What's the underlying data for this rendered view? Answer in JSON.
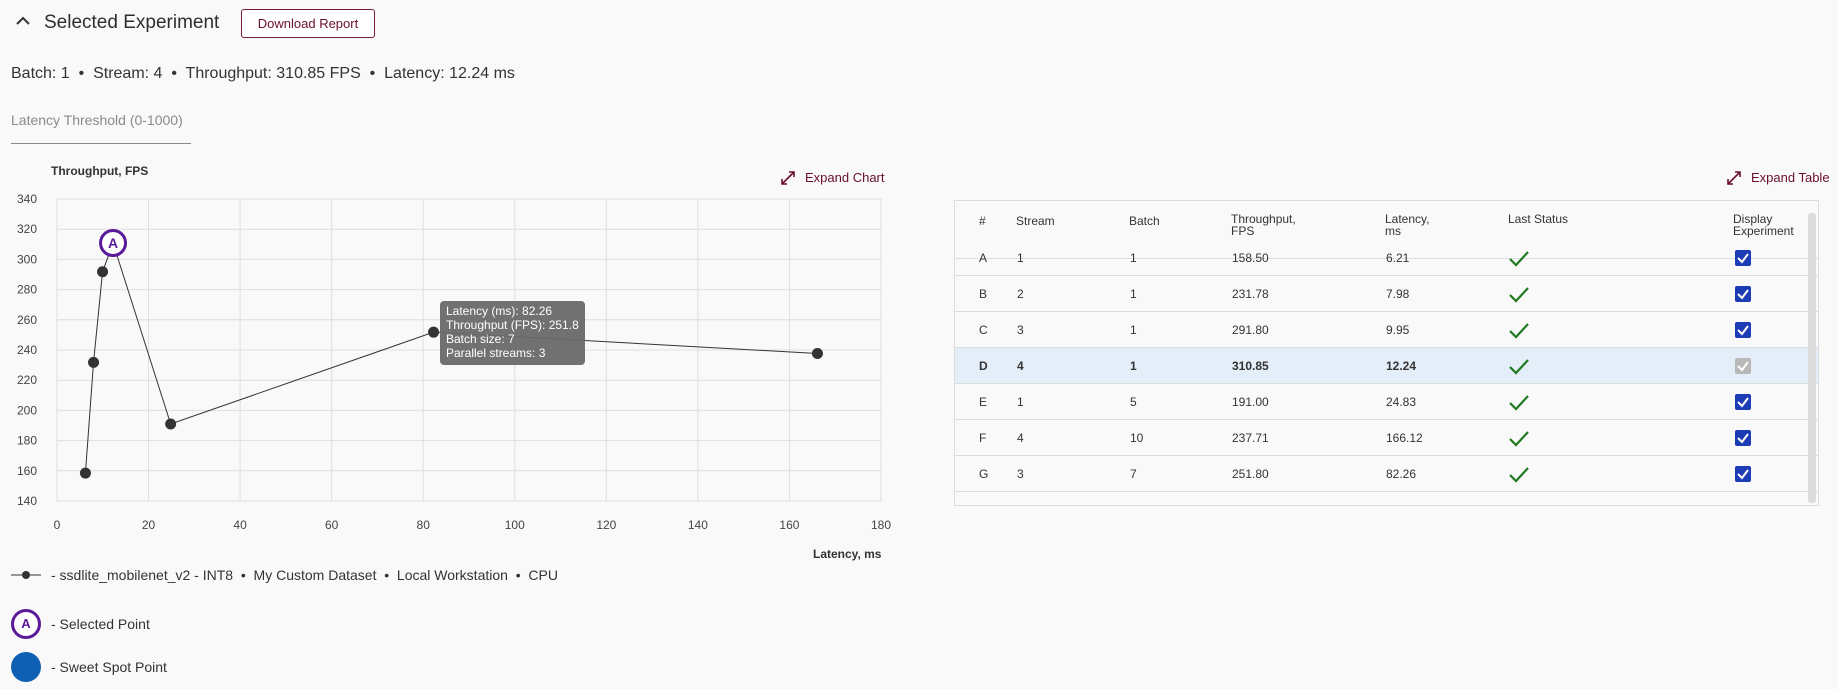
{
  "header": {
    "title": "Selected Experiment",
    "download_label": "Download Report"
  },
  "summary": "Batch: 1  •  Stream: 4  •  Throughput: 310.85 FPS  •  Latency: 12.24 ms",
  "threshold": {
    "placeholder": "Latency Threshold (0-1000)",
    "value": ""
  },
  "chart_controls": {
    "expand_label": "Expand Chart"
  },
  "table_controls": {
    "expand_label": "Expand Table"
  },
  "chart_data": {
    "type": "line",
    "ylabel": "Throughput, FPS",
    "xlabel": "Latency, ms",
    "xlim": [
      0,
      180
    ],
    "ylim": [
      140,
      340
    ],
    "x_ticks": [
      0,
      20,
      40,
      60,
      80,
      100,
      120,
      140,
      160,
      180
    ],
    "y_ticks": [
      140,
      160,
      180,
      200,
      220,
      240,
      260,
      280,
      300,
      320,
      340
    ],
    "grid": true,
    "series": [
      {
        "name": "ssdlite_mobilenet_v2 - INT8",
        "points": [
          {
            "x": 6.21,
            "y": 158.5
          },
          {
            "x": 7.98,
            "y": 231.78
          },
          {
            "x": 9.95,
            "y": 291.8
          },
          {
            "x": 12.24,
            "y": 310.85
          },
          {
            "x": 24.83,
            "y": 191.0
          },
          {
            "x": 82.26,
            "y": 251.8
          },
          {
            "x": 166.12,
            "y": 237.71
          }
        ]
      }
    ],
    "selected_point": {
      "label": "A",
      "x": 12.24,
      "y": 310.85
    },
    "tooltip": {
      "latency": "Latency (ms): 82.26",
      "throughput": "Throughput (FPS): 251.8",
      "batch": "Batch size: 7",
      "streams": "Parallel streams: 3"
    }
  },
  "legend": {
    "series_text": "- ssdlite_mobilenet_v2 - INT8  •  My Custom Dataset  •  Local Workstation  •  CPU",
    "selected_marker_letter": "A",
    "selected_text": "- Selected Point",
    "sweet_text": "- Sweet Spot Point",
    "colors": {
      "selected": "#5a1a99",
      "sweet": "#0f5fb3",
      "line": "#333333"
    }
  },
  "table": {
    "columns": {
      "num": "#",
      "stream": "Stream",
      "batch": "Batch",
      "throughput_1": "Throughput,",
      "throughput_2": "FPS",
      "latency_1": "Latency,",
      "latency_2": "ms",
      "status": "Last Status",
      "display_1": "Display",
      "display_2": "Experiment"
    },
    "rows": [
      {
        "id": "A",
        "stream": "1",
        "batch": "1",
        "throughput": "158.50",
        "latency": "6.21",
        "checked": true
      },
      {
        "id": "B",
        "stream": "2",
        "batch": "1",
        "throughput": "231.78",
        "latency": "7.98",
        "checked": true
      },
      {
        "id": "C",
        "stream": "3",
        "batch": "1",
        "throughput": "291.80",
        "latency": "9.95",
        "checked": true
      },
      {
        "id": "D",
        "stream": "4",
        "batch": "1",
        "throughput": "310.85",
        "latency": "12.24",
        "checked": true,
        "selected": true
      },
      {
        "id": "E",
        "stream": "1",
        "batch": "5",
        "throughput": "191.00",
        "latency": "24.83",
        "checked": true
      },
      {
        "id": "F",
        "stream": "4",
        "batch": "10",
        "throughput": "237.71",
        "latency": "166.12",
        "checked": true
      },
      {
        "id": "G",
        "stream": "3",
        "batch": "7",
        "throughput": "251.80",
        "latency": "82.26",
        "checked": true
      }
    ]
  }
}
